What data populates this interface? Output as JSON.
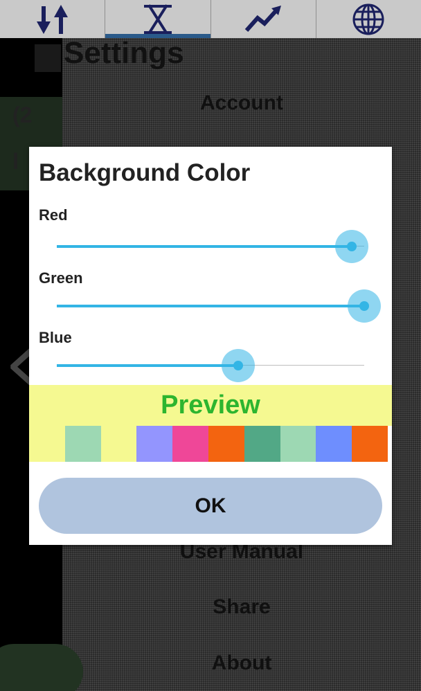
{
  "tabs": [
    {
      "name": "sort-arrows",
      "active": false
    },
    {
      "name": "hourglass",
      "active": true
    },
    {
      "name": "trend-chart",
      "active": false
    },
    {
      "name": "globe",
      "active": false
    }
  ],
  "background": {
    "title": "Settings",
    "left_text_1": "(2",
    "left_text_2": "l",
    "menu": [
      "Account",
      "User Manual",
      "Share",
      "About"
    ]
  },
  "dialog": {
    "title": "Background Color",
    "sliders": [
      {
        "label": "Red",
        "value": 0.96
      },
      {
        "label": "Green",
        "value": 1.0
      },
      {
        "label": "Blue",
        "value": 0.59
      }
    ],
    "preview_label": "Preview",
    "preview_bg": "#f5f991",
    "preview_text_color": "#2db52f",
    "swatches": [
      "#f5f991",
      "#9dd8b3",
      "#f5f991",
      "#9395fe",
      "#ef4798",
      "#f36410",
      "#52a886",
      "#9dd8b3",
      "#6e8efe",
      "#f36410"
    ],
    "ok_label": "OK"
  },
  "colors": {
    "accent": "#33b5e5",
    "ok_button": "#b0c4de",
    "tab_active_indicator": "#2a5a8a",
    "icon_navy": "#1a1f5c"
  }
}
